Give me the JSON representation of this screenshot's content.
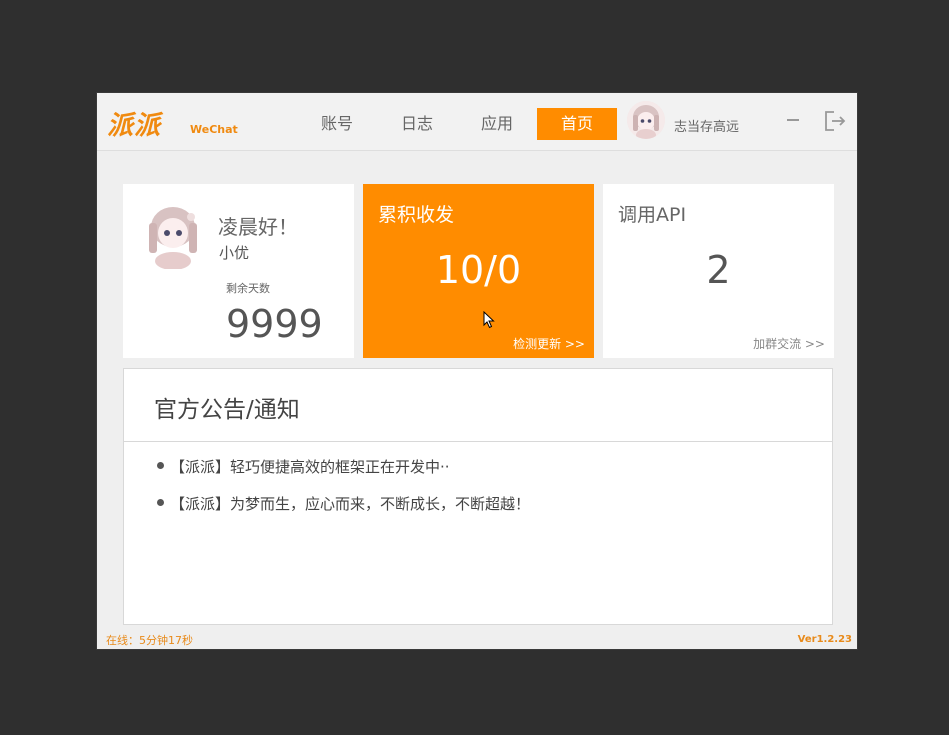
{
  "header": {
    "logo_text": "派派",
    "logo_sub": "WeChat",
    "nav": [
      {
        "label": "账号"
      },
      {
        "label": "日志"
      },
      {
        "label": "应用"
      },
      {
        "label": "首页",
        "active": true
      }
    ],
    "username": "志当存高远"
  },
  "cards": {
    "profile": {
      "greeting": "凌晨好！",
      "nickname": "小优",
      "days_label": "剩余天数",
      "days_value": "9999"
    },
    "messages": {
      "title": "累积收发",
      "value": "10/0",
      "link": "检测更新 >>"
    },
    "api": {
      "title": "调用API",
      "value": "2",
      "link": "加群交流 >>"
    }
  },
  "notice": {
    "title": "官方公告/通知",
    "items": [
      "【派派】轻巧便捷高效的框架正在开发中··",
      "【派派】为梦而生，应心而来，不断成长，不断超越！"
    ]
  },
  "status": {
    "online": "在线：5分钟17秒",
    "version": "Ver1.2.23"
  },
  "colors": {
    "accent": "#ff8c00",
    "background": "#efefef",
    "desktop": "#2f2f2f"
  },
  "icons": [
    "minimize-icon",
    "logout-icon",
    "cursor-icon"
  ]
}
